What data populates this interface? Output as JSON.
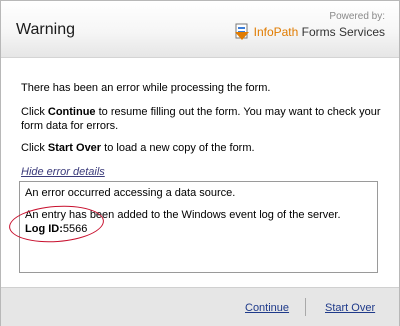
{
  "dialog": {
    "title": "Warning",
    "powered_by": "Powered by:",
    "brand_infopath": "InfoPath",
    "brand_rest": " Forms Services"
  },
  "message": {
    "line1": "There has been an error while processing the form.",
    "line2_prefix": "Click ",
    "line2_bold": "Continue",
    "line2_suffix": " to resume filling out the form. You may want to check your form data for errors.",
    "line3_prefix": "Click ",
    "line3_bold": "Start Over",
    "line3_suffix": " to load a new copy of the form."
  },
  "error_toggle": "Hide error details",
  "error_details": {
    "line1": "An error occurred accessing a data source.",
    "line2": "An entry has been added to the Windows event log of the server.",
    "log_label": "Log ID:",
    "log_value": "5566"
  },
  "footer": {
    "continue_label": "Continue",
    "start_over_label": "Start Over"
  },
  "colors": {
    "annotation_oval": "#c8102e",
    "link": "#1f3a8a",
    "footer_bg": "#e6e6e6"
  }
}
